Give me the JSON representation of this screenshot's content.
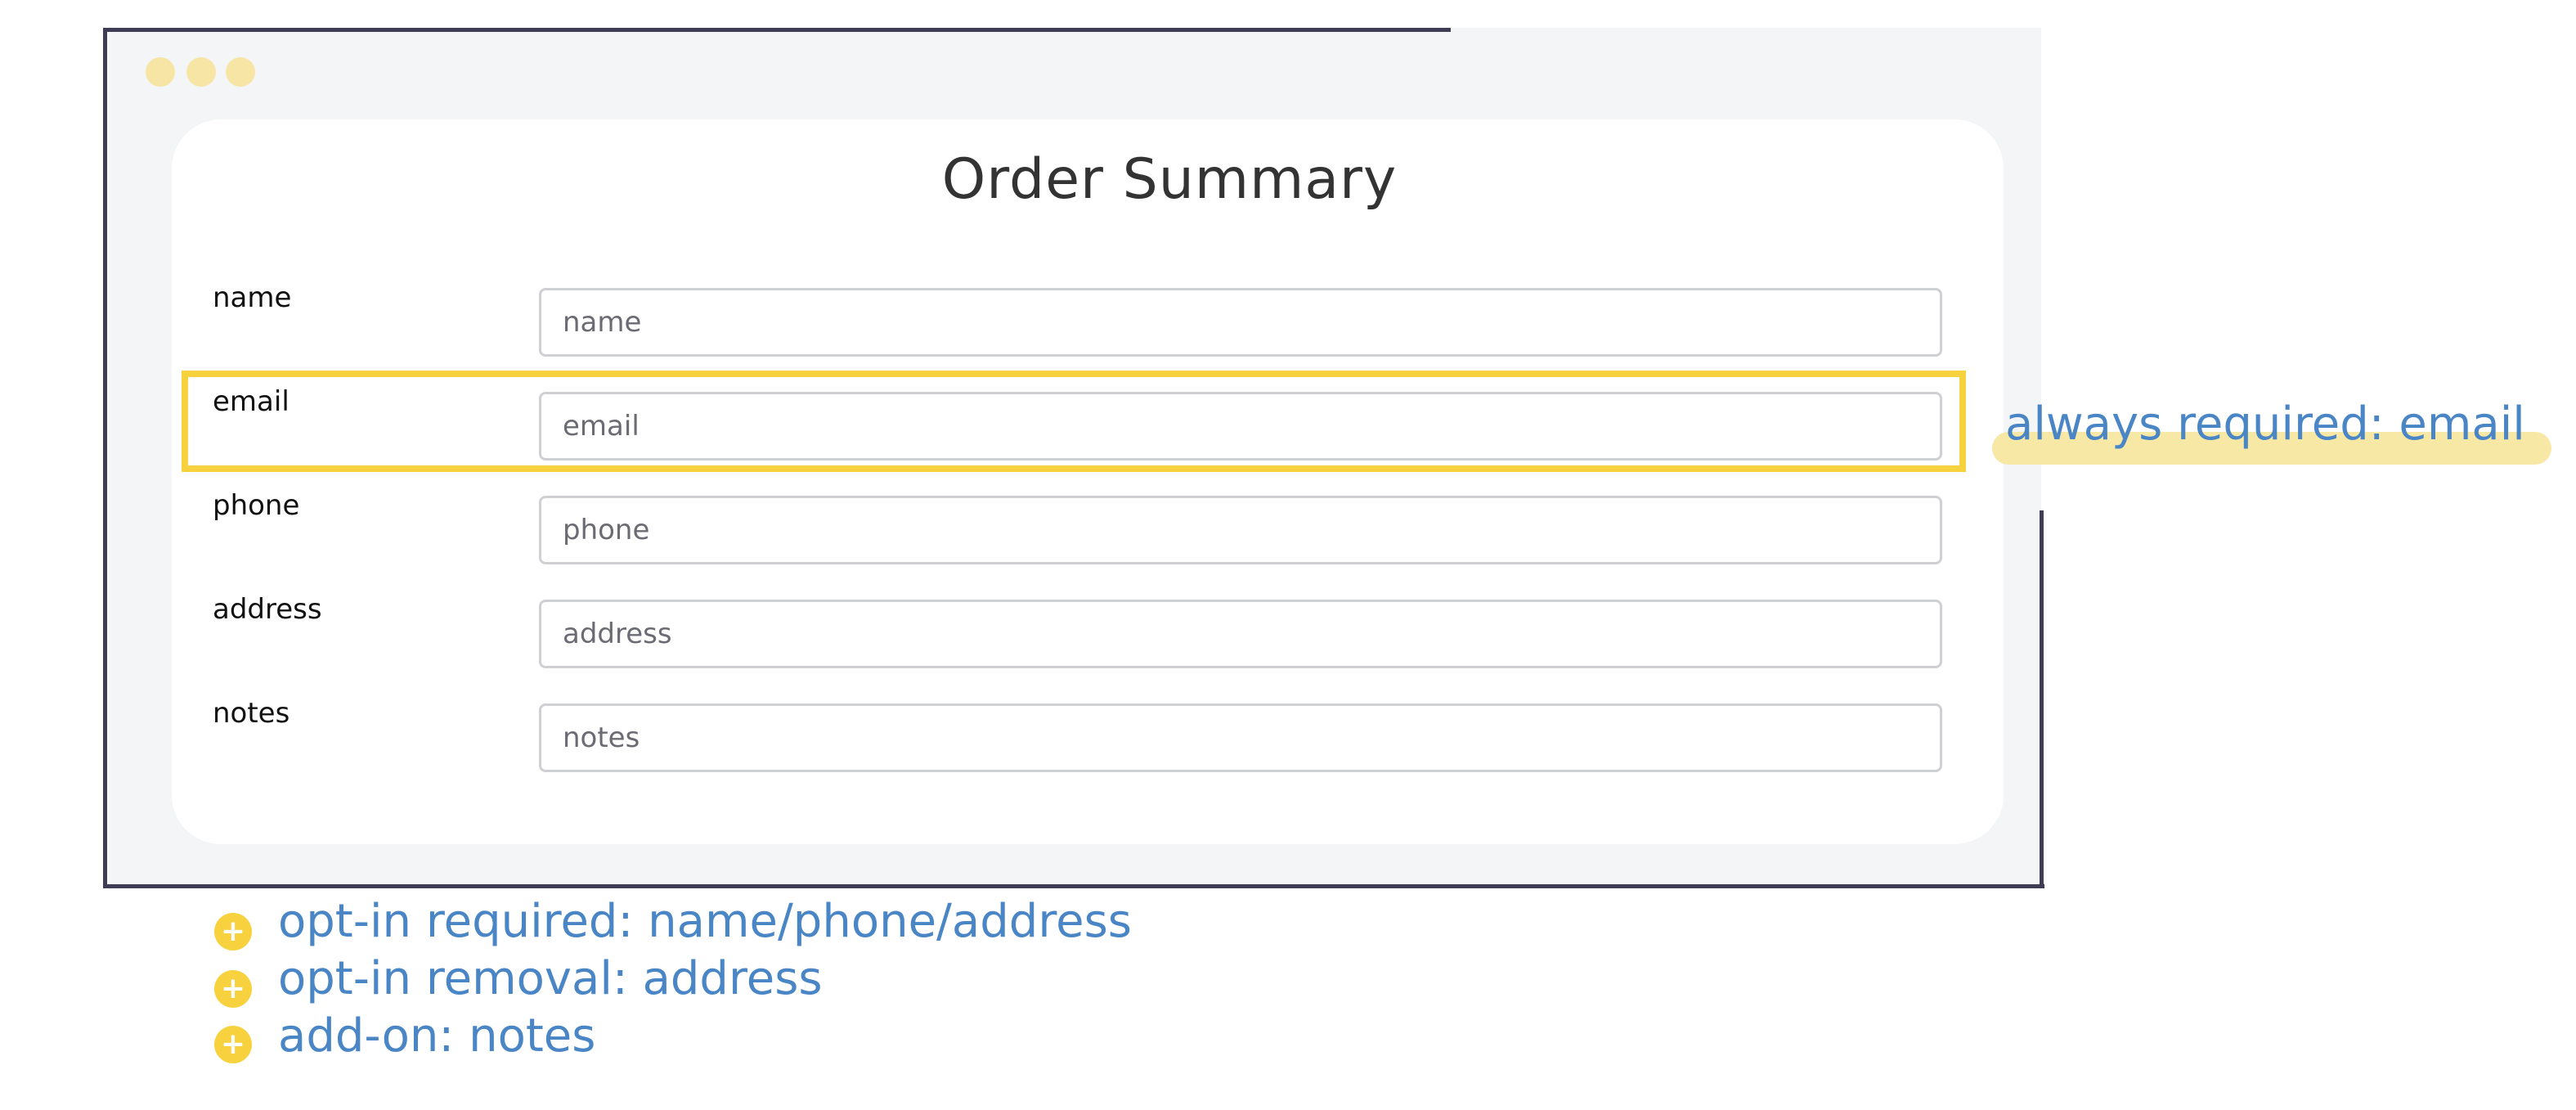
{
  "form": {
    "title": "Order Summary",
    "fields": [
      {
        "label": "name",
        "placeholder": "name"
      },
      {
        "label": "email",
        "placeholder": "email"
      },
      {
        "label": "phone",
        "placeholder": "phone"
      },
      {
        "label": "address",
        "placeholder": "address"
      },
      {
        "label": "notes",
        "placeholder": "notes"
      }
    ]
  },
  "annotations": {
    "callout": "always required: email",
    "notes": [
      {
        "icon": "plus-circle-icon",
        "text": "opt-in required: name/phone/address"
      },
      {
        "icon": "plus-circle-icon",
        "text": "opt-in removal: address"
      },
      {
        "icon": "plus-circle-icon",
        "text": "add-on: notes"
      }
    ]
  },
  "colors": {
    "frame": "#3f3d56",
    "window_bg": "#f4f5f7",
    "highlight": "#f7d23e",
    "annotation_text": "#4a86c5",
    "window_dots": "#f7e5a6"
  }
}
